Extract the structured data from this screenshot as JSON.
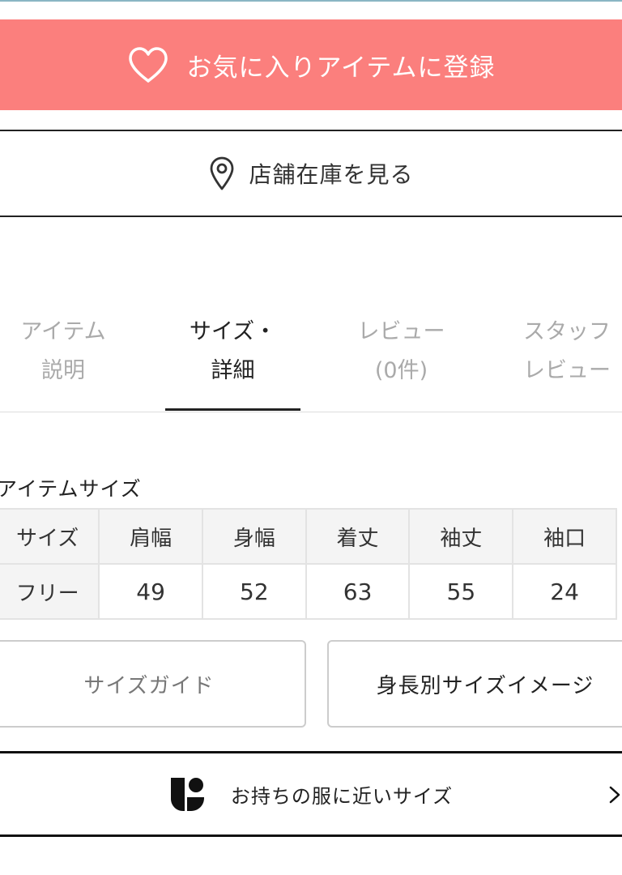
{
  "favorite": {
    "label": "お気に入りアイテムに登録",
    "icon": "heart-outline-icon",
    "bg_color": "#fb7f7d"
  },
  "store_stock": {
    "label": "店舗在庫を見る",
    "icon": "map-pin-icon"
  },
  "tabs": [
    {
      "lines": [
        "アイテム",
        "説明"
      ],
      "active": false
    },
    {
      "lines": [
        "サイズ・",
        "詳細"
      ],
      "active": true
    },
    {
      "lines": [
        "レビュー",
        "(0件)"
      ],
      "active": false
    },
    {
      "lines": [
        "スタッフ",
        "レビュー"
      ],
      "active": false
    }
  ],
  "size_section": {
    "title": "アイテムサイズ",
    "headers": [
      "サイズ",
      "肩幅",
      "身幅",
      "着丈",
      "袖丈",
      "袖口"
    ],
    "rows": [
      [
        "フリー",
        "49",
        "52",
        "63",
        "55",
        "24"
      ]
    ]
  },
  "buttons": {
    "size_guide": "サイズガイド",
    "height_image": "身長別サイズイメージ"
  },
  "fit": {
    "label": "お持ちの服に近いサイズ",
    "icon": "brand-logo-icon",
    "chevron": "chevron-right-icon"
  }
}
